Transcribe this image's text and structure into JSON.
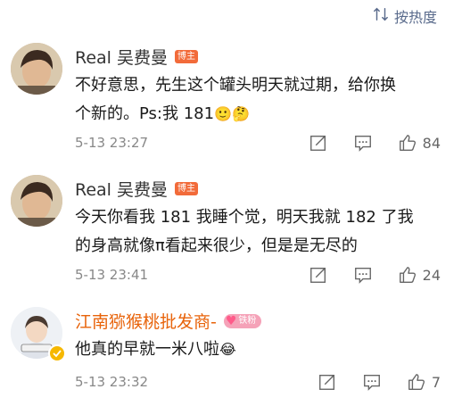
{
  "sort": {
    "icon": "sort-icon",
    "label": "按热度"
  },
  "comments": [
    {
      "username": "Real 吴费曼",
      "badge": "博主",
      "text_line1": "不好意思，先生这个罐头明天就过期，给你换",
      "text_line2": "个新的。Ps:我 181",
      "emojis": "🙂🤔",
      "time": "5-13 23:27",
      "likes": "84"
    },
    {
      "username": "Real 吴费曼",
      "badge": "博主",
      "text_line1": "今天你看我 181 我睡个觉，明天我就 182 了我",
      "text_line2": "的身高就像π看起来很少，但是是无尽的",
      "time": "5-13 23:41",
      "likes": "24"
    },
    {
      "username": "江南猕猴桃批发商-",
      "fan_badge": "铁粉",
      "text_line1": "他真的早就一米八啦",
      "emojis": "😂",
      "time": "5-13 23:32",
      "likes": "7"
    }
  ],
  "colors": {
    "accent": "#f26b3a",
    "link": "#5a6b8c",
    "orange_name": "#e8630a"
  }
}
